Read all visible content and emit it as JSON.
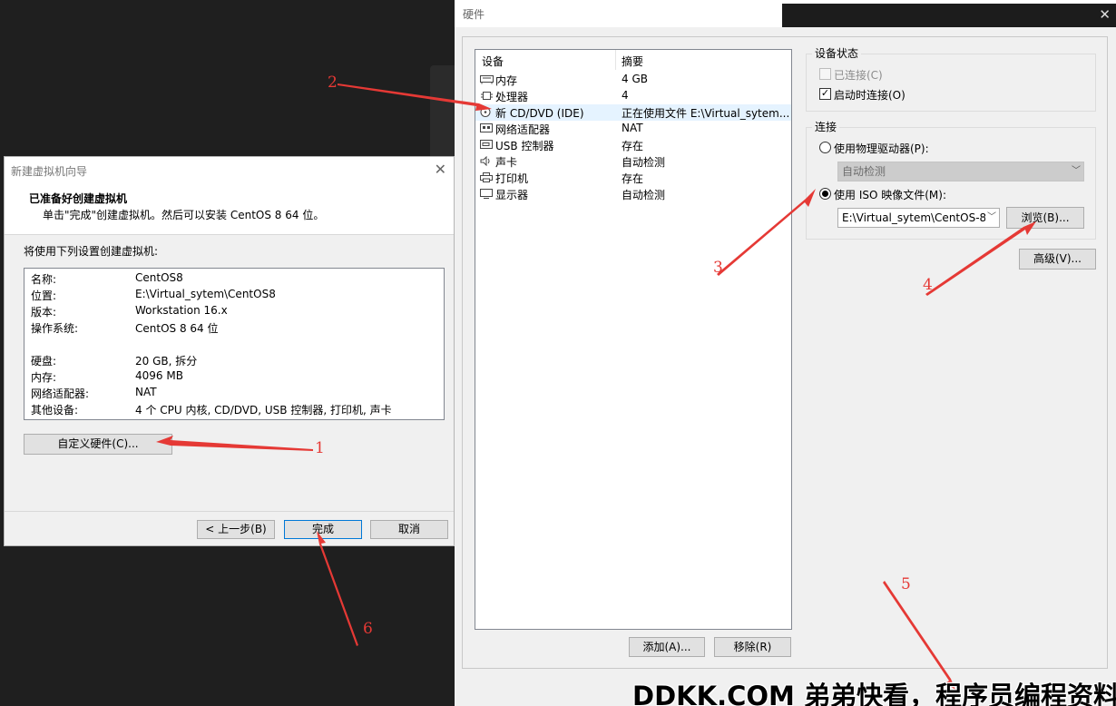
{
  "hardware": {
    "title": "硬件",
    "device_header": "设备",
    "summary_header": "摘要",
    "devices": [
      {
        "name": "内存",
        "summary": "4 GB",
        "icon": "memory-icon"
      },
      {
        "name": "处理器",
        "summary": "4",
        "icon": "cpu-icon"
      },
      {
        "name": "新 CD/DVD (IDE)",
        "summary": "正在使用文件 E:\\Virtual_sytem...",
        "icon": "cd-dvd-icon",
        "selected": true
      },
      {
        "name": "网络适配器",
        "summary": "NAT",
        "icon": "network-adapter-icon"
      },
      {
        "name": "USB 控制器",
        "summary": "存在",
        "icon": "usb-icon"
      },
      {
        "name": "声卡",
        "summary": "自动检测",
        "icon": "sound-icon"
      },
      {
        "name": "打印机",
        "summary": "存在",
        "icon": "printer-icon"
      },
      {
        "name": "显示器",
        "summary": "自动检测",
        "icon": "display-icon"
      }
    ],
    "add_button": "添加(A)...",
    "remove_button": "移除(R)",
    "device_status": {
      "title": "设备状态",
      "connected_label": "已连接(C)",
      "connected": false,
      "connect_on_power_label": "启动时连接(O)",
      "connect_on_power": true
    },
    "connection": {
      "title": "连接",
      "physical_label": "使用物理驱动器(P):",
      "physical_value": "自动检测",
      "iso_label": "使用 ISO 映像文件(M):",
      "iso_value": "E:\\Virtual_sytem\\CentOS-8.",
      "browse_button": "浏览(B)...",
      "selected": "iso"
    },
    "advanced_button": "高级(V)..."
  },
  "wizard": {
    "title": "新建虚拟机向导",
    "heading": "已准备好创建虚拟机",
    "subheading": "单击\"完成\"创建虚拟机。然后可以安装 CentOS 8 64 位。",
    "intro": "将使用下列设置创建虚拟机:",
    "summary": [
      {
        "key": "名称:",
        "value": "CentOS8"
      },
      {
        "key": "位置:",
        "value": "E:\\Virtual_sytem\\CentOS8"
      },
      {
        "key": "版本:",
        "value": "Workstation 16.x"
      },
      {
        "key": "操作系统:",
        "value": "CentOS 8 64 位"
      },
      {
        "key": "",
        "value": ""
      },
      {
        "key": "硬盘:",
        "value": "20 GB, 拆分"
      },
      {
        "key": "内存:",
        "value": "4096 MB"
      },
      {
        "key": "网络适配器:",
        "value": "NAT"
      },
      {
        "key": "其他设备:",
        "value": "4 个 CPU 内核, CD/DVD, USB 控制器, 打印机, 声卡"
      }
    ],
    "customize_button": "自定义硬件(C)...",
    "back_button": "< 上一步(B)",
    "finish_button": "完成",
    "cancel_button": "取消"
  },
  "annotations": [
    "1",
    "2",
    "3",
    "4",
    "5",
    "6"
  ],
  "watermark": "DDKK.COM 弟弟快看，程序员编程资料站",
  "colors": {
    "annotation": "#e53935",
    "selected_row": "#e5f3ff",
    "focus_border": "#0078d7"
  }
}
